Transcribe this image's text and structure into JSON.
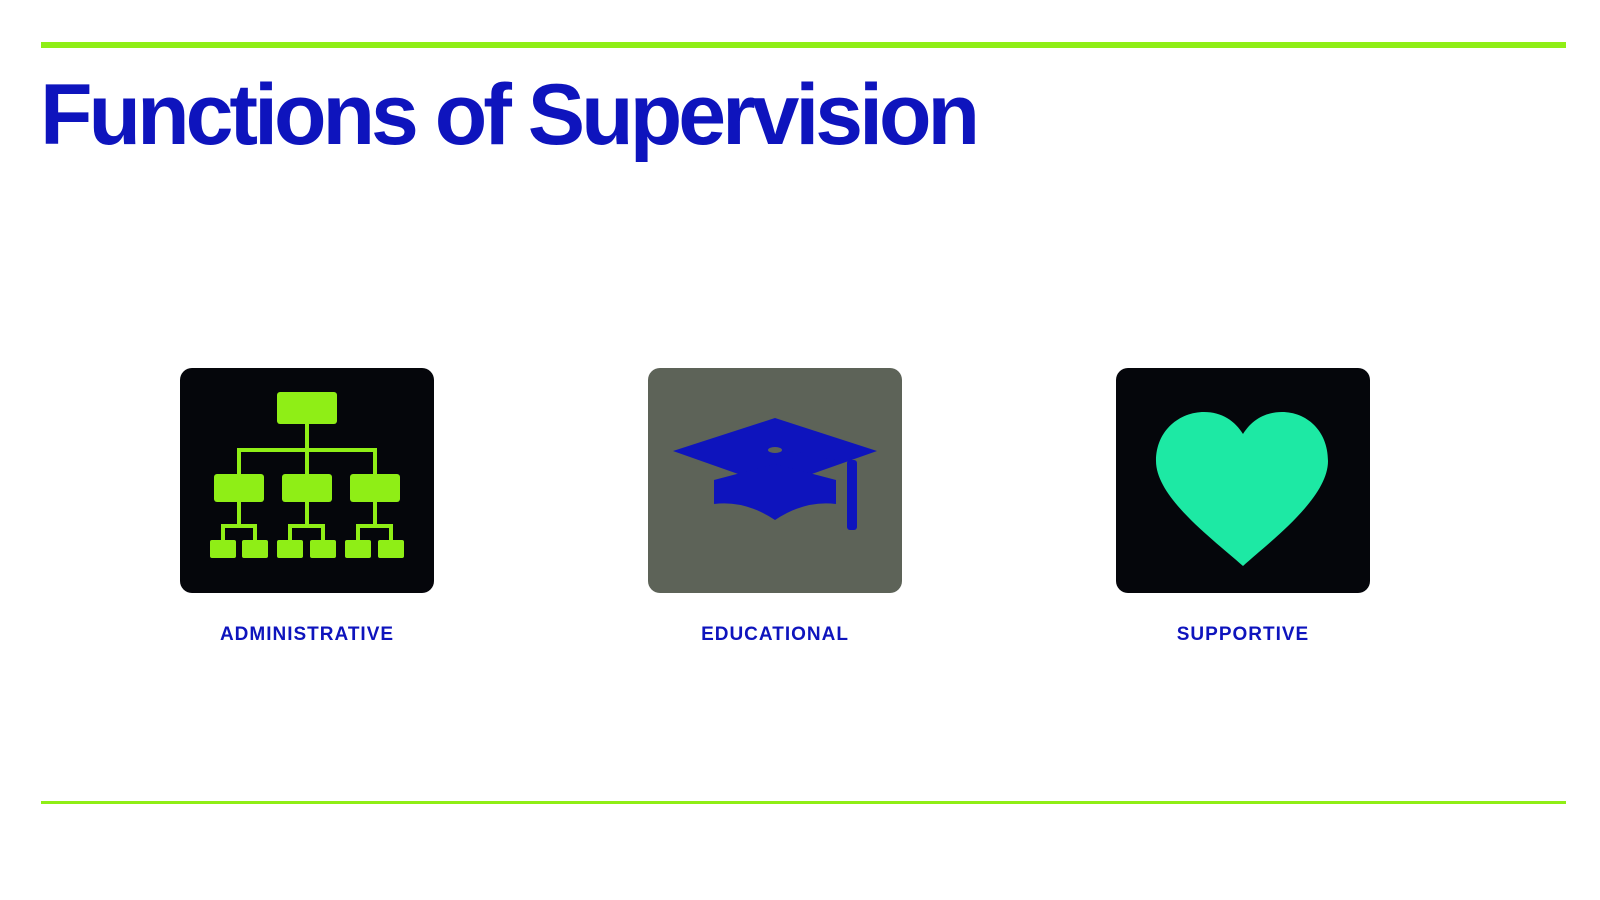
{
  "slide": {
    "title": "Functions of Supervision",
    "colors": {
      "title": "#0e14bd",
      "rule": "#8fee16",
      "label": "#0e14bd"
    }
  },
  "functions": [
    {
      "label": "ADMINISTRATIVE",
      "icon": "org-chart-icon",
      "card_color": "#05060b",
      "icon_color": "#8fee16"
    },
    {
      "label": "EDUCATIONAL",
      "icon": "graduation-cap-icon",
      "card_color": "#5d6358",
      "icon_color": "#0e14bd"
    },
    {
      "label": "SUPPORTIVE",
      "icon": "heart-icon",
      "card_color": "#05060b",
      "icon_color": "#1de9a4"
    }
  ]
}
